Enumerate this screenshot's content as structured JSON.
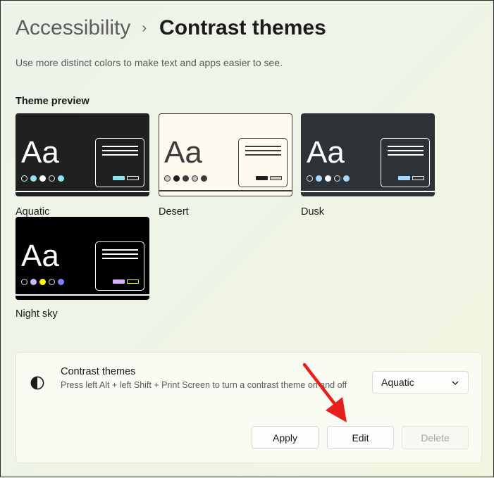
{
  "header": {
    "parent": "Accessibility",
    "separator": "›",
    "current": "Contrast themes",
    "subtitle": "Use more distinct colors to make text and apps easier to see."
  },
  "preview": {
    "label": "Theme preview",
    "sample_text": "Aa",
    "themes": [
      {
        "name": "Aquatic",
        "bg": "#202020",
        "fg": "#ffffff",
        "accent": "#8ee3f0"
      },
      {
        "name": "Desert",
        "bg": "#fffaef",
        "fg": "#3d3d3d",
        "accent": "#202020"
      },
      {
        "name": "Dusk",
        "bg": "#2d3236",
        "fg": "#ffffff",
        "accent": "#a6d8ff"
      },
      {
        "name": "Night sky",
        "bg": "#000000",
        "fg": "#ffffff",
        "accent": "#d6b4fd"
      }
    ]
  },
  "settings_card": {
    "icon": "contrast-icon",
    "title": "Contrast themes",
    "description": "Press left Alt + left Shift + Print Screen to turn a contrast theme on and off",
    "selected_theme": "Aquatic",
    "apply_label": "Apply",
    "edit_label": "Edit",
    "delete_label": "Delete"
  },
  "annotation": {
    "color": "#e8201d"
  }
}
